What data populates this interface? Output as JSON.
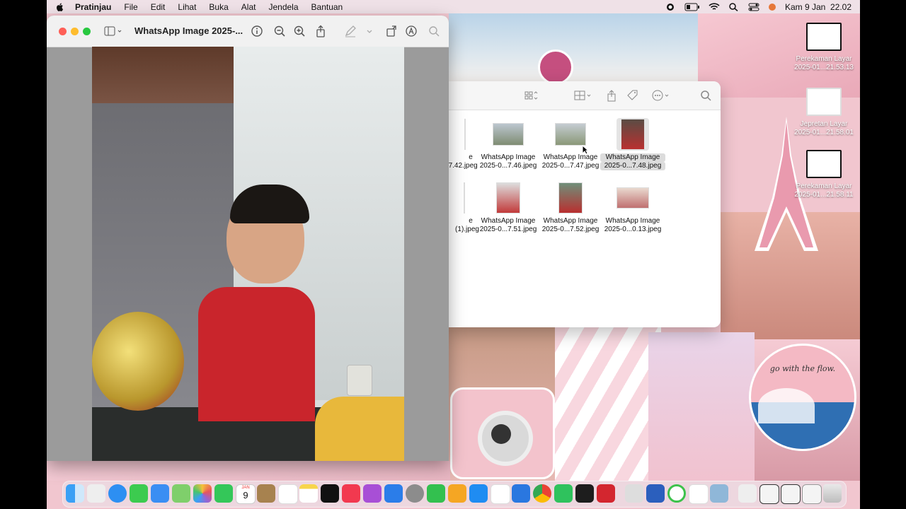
{
  "menubar": {
    "app_name": "Pratinjau",
    "items": [
      "File",
      "Edit",
      "Lihat",
      "Buka",
      "Alat",
      "Jendela",
      "Bantuan"
    ],
    "clock": "Kam 9 Jan  22.02"
  },
  "preview": {
    "title": "WhatsApp Image 2025-..."
  },
  "finder": {
    "files": [
      {
        "line1": "e",
        "line2": "...7.42.jpeg",
        "selected": false
      },
      {
        "line1": "WhatsApp Image",
        "line2": "2025-0...7.46.jpeg",
        "selected": false
      },
      {
        "line1": "WhatsApp Image",
        "line2": "2025-0...7.47.jpeg",
        "selected": false
      },
      {
        "line1": "WhatsApp Image",
        "line2": "2025-0...7.48.jpeg",
        "selected": true
      },
      {
        "line1": "e",
        "line2": "(1).jpeg",
        "selected": false
      },
      {
        "line1": "WhatsApp Image",
        "line2": "2025-0...7.51.jpeg",
        "selected": false
      },
      {
        "line1": "WhatsApp Image",
        "line2": "2025-0...7.52.jpeg",
        "selected": false
      },
      {
        "line1": "WhatsApp Image",
        "line2": "2025-0...0.13.jpeg",
        "selected": false
      }
    ]
  },
  "desktop_icons": [
    {
      "line1": "Perekaman Layar",
      "line2": "2025-01...21.53.13"
    },
    {
      "line1": "Jepretan Layar",
      "line2": "2025-01...21.58.01"
    },
    {
      "line1": "Perekaman Layar",
      "line2": "2025-01...21.58.11"
    }
  ],
  "wallpaper": {
    "sticker_text": "go with the flow."
  },
  "dock": {
    "calendar_month": "JAN",
    "calendar_day": "9"
  }
}
